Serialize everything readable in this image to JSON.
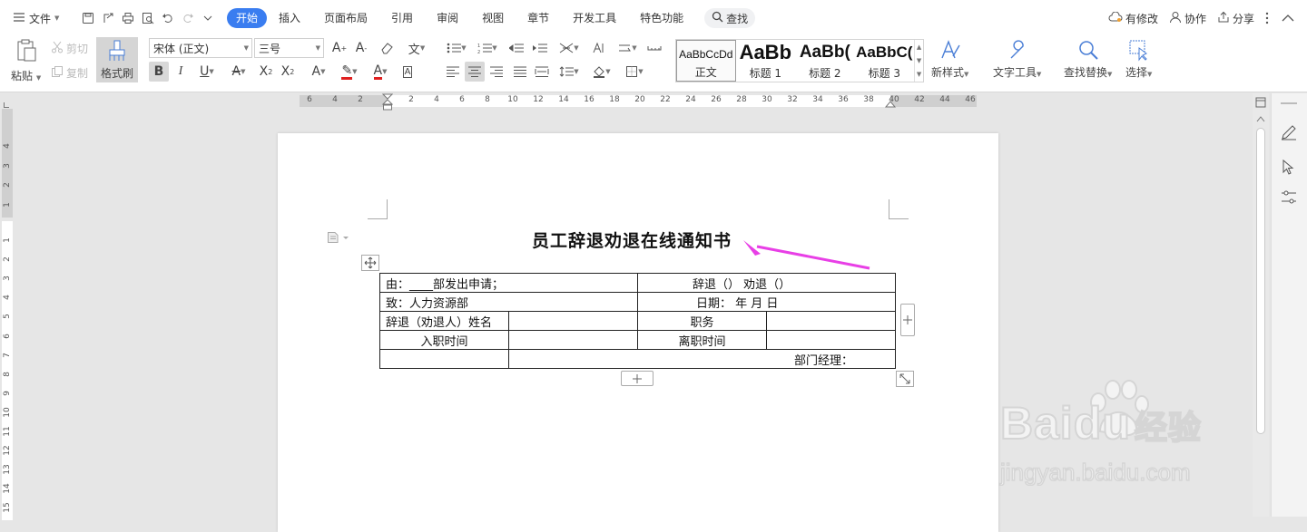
{
  "menubar": {
    "file_label": "文件",
    "tabs": [
      {
        "label": "开始",
        "active": true
      },
      {
        "label": "插入"
      },
      {
        "label": "页面布局"
      },
      {
        "label": "引用"
      },
      {
        "label": "审阅"
      },
      {
        "label": "视图"
      },
      {
        "label": "章节"
      },
      {
        "label": "开发工具"
      },
      {
        "label": "特色功能"
      }
    ],
    "search_label": "查找",
    "right": {
      "modify": "有修改",
      "collab": "协作",
      "share": "分享"
    }
  },
  "toolbar": {
    "paste": "粘贴",
    "cut": "剪切",
    "copy": "复制",
    "format_painter": "格式刷",
    "font_name": "宋体 (正文)",
    "font_size": "三号",
    "styles": [
      {
        "preview": "AaBbCcDd",
        "name": "正文"
      },
      {
        "preview": "AaBb",
        "name": "标题 1"
      },
      {
        "preview": "AaBb(",
        "name": "标题 2"
      },
      {
        "preview": "AaBbC(",
        "name": "标题 3"
      }
    ],
    "new_style": "新样式",
    "text_tools": "文字工具",
    "find_replace": "查找替换",
    "select": "选择"
  },
  "ruler": {
    "h_numbers": [
      "6",
      "4",
      "2",
      "2",
      "4",
      "6",
      "8",
      "10",
      "12",
      "14",
      "16",
      "18",
      "20",
      "22",
      "24",
      "26",
      "28",
      "30",
      "32",
      "34",
      "36",
      "38",
      "40",
      "42",
      "44",
      "46"
    ],
    "v_numbers": [
      "4",
      "3",
      "2",
      "1",
      "1",
      "2",
      "3",
      "4",
      "5",
      "6",
      "7",
      "8",
      "9",
      "10",
      "11",
      "12",
      "13",
      "14",
      "15"
    ]
  },
  "document": {
    "title": "员工辞退劝退在线通知书",
    "table": {
      "row1_left": "由：____部发出申请；",
      "row1_right": "辞退（）      劝退（）",
      "row2_left": "致：人力资源部",
      "row2_right": "日期：   年     月     日",
      "row3": [
        "辞退（劝退人）姓名",
        "",
        "职务",
        ""
      ],
      "row4": [
        "入职时间",
        "",
        "离职时间",
        ""
      ],
      "row5_right": "部门经理："
    }
  },
  "watermark": {
    "brand": "Baidu",
    "brand_cn": "经验",
    "url": "jingyan.baidu.com"
  },
  "colors": {
    "accent": "#3a7df0",
    "arrow": "#e83fe6"
  }
}
